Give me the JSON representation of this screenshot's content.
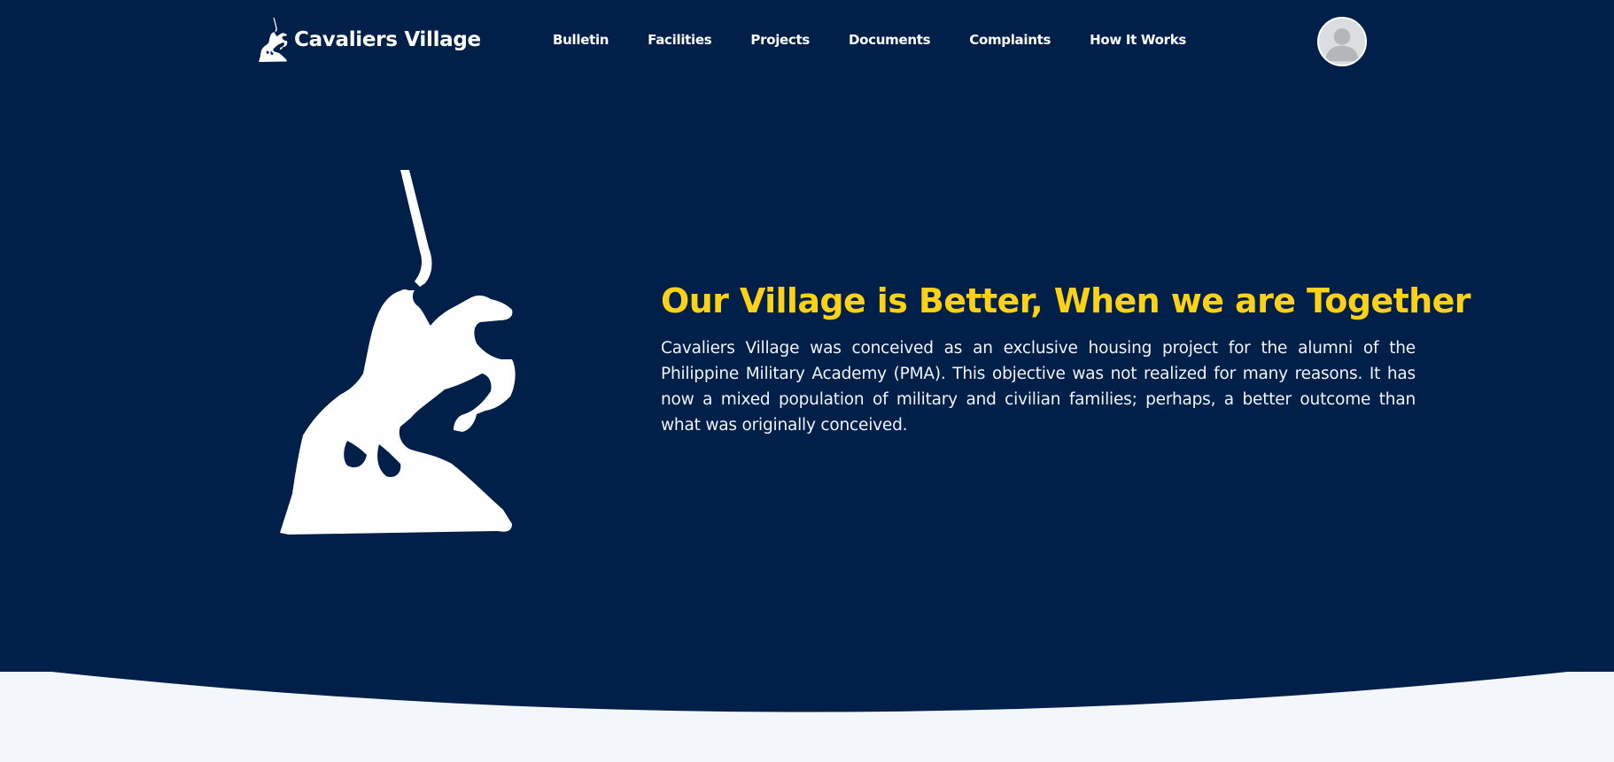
{
  "header": {
    "brand_name": "Cavaliers Village",
    "logo_icon": "horse-rider-statue-icon",
    "nav": [
      {
        "label": "Bulletin"
      },
      {
        "label": "Facilities"
      },
      {
        "label": "Projects"
      },
      {
        "label": "Documents"
      },
      {
        "label": "Complaints"
      },
      {
        "label": "How It Works"
      }
    ],
    "avatar_icon": "user-avatar-icon"
  },
  "hero": {
    "image_icon": "horse-rider-statue-icon",
    "title": "Our Village is Better, When we are Together",
    "description": "Cavaliers Village was conceived as an exclusive housing project for the alumni of the Philippine Military Academy (PMA). This objective was not realized for many reasons. It has now a mixed population of military and civilian families; perhaps, a better outcome than what was originally conceived."
  },
  "colors": {
    "hero_background": "#00204a",
    "headline": "#fcd116",
    "text": "#ffffff",
    "page_background": "#f3f6fa"
  }
}
